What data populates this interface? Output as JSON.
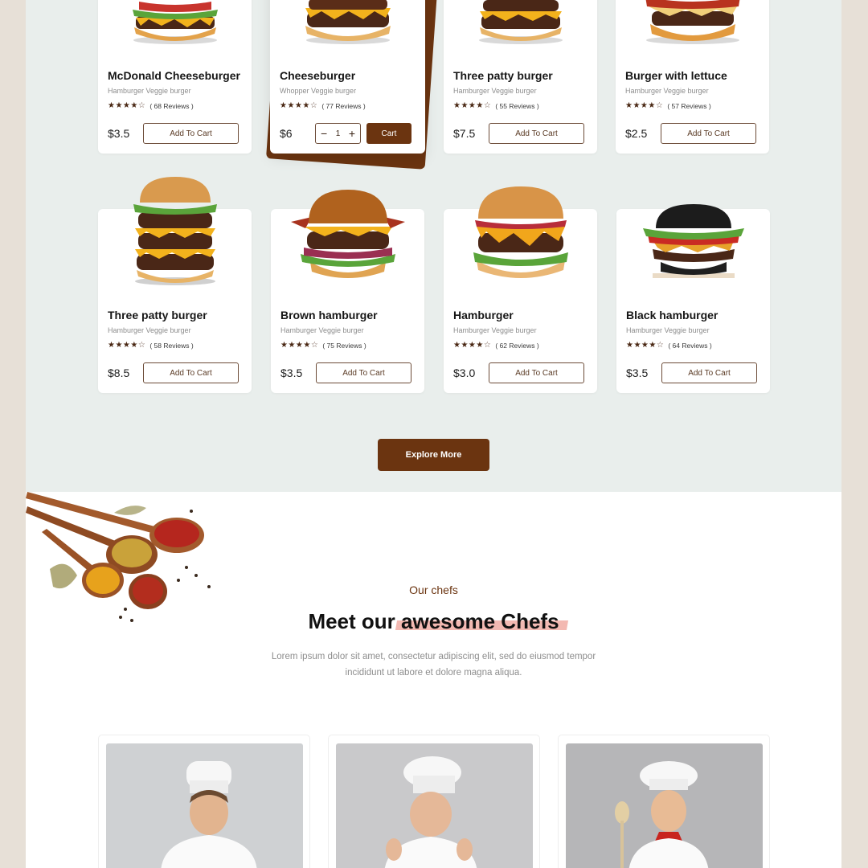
{
  "products": {
    "row1": [
      {
        "name": "McDonald Cheeseburger",
        "sub": "Hamburger Veggie burger",
        "reviews": "( 68 Reviews )",
        "price": "$3.5",
        "button": "Add To Cart"
      },
      {
        "name": "Cheeseburger",
        "sub": "Whopper Veggie burger",
        "reviews": "( 77 Reviews )",
        "price": "$6",
        "qty": "1",
        "minus": "−",
        "plus": "+",
        "button": "Cart"
      },
      {
        "name": "Three patty burger",
        "sub": "Hamburger Veggie burger",
        "reviews": "( 55 Reviews )",
        "price": "$7.5",
        "button": "Add To Cart"
      },
      {
        "name": "Burger with lettuce",
        "sub": "Hamburger Veggie burger",
        "reviews": "( 57 Reviews )",
        "price": "$2.5",
        "button": "Add To Cart"
      }
    ],
    "row2": [
      {
        "name": "Three patty burger",
        "sub": "Hamburger Veggie burger",
        "reviews": "( 58 Reviews )",
        "price": "$8.5",
        "button": "Add To Cart"
      },
      {
        "name": "Brown hamburger",
        "sub": "Hamburger Veggie burger",
        "reviews": "( 75 Reviews )",
        "price": "$3.5",
        "button": "Add To Cart"
      },
      {
        "name": "Hamburger",
        "sub": "Hamburger Veggie burger",
        "reviews": "( 62 Reviews )",
        "price": "$3.0",
        "button": "Add To Cart"
      },
      {
        "name": "Black hamburger",
        "sub": "Hamburger Veggie burger",
        "reviews": "( 64 Reviews )",
        "price": "$3.5",
        "button": "Add To Cart"
      }
    ],
    "rating": 4,
    "rating_max": 5,
    "explore_label": "Explore More"
  },
  "chefs": {
    "eyebrow": "Our chefs",
    "title_plain": "Meet our ",
    "title_accent": "awesome Chefs",
    "description": "Lorem ipsum dolor sit amet, consectetur adipiscing elit, sed do eiusmod tempor incididunt ut labore et dolore magna aliqua."
  },
  "colors": {
    "brand": "#6b3410",
    "section_bg": "#e9eeec",
    "highlight": "#f3b9b2"
  }
}
